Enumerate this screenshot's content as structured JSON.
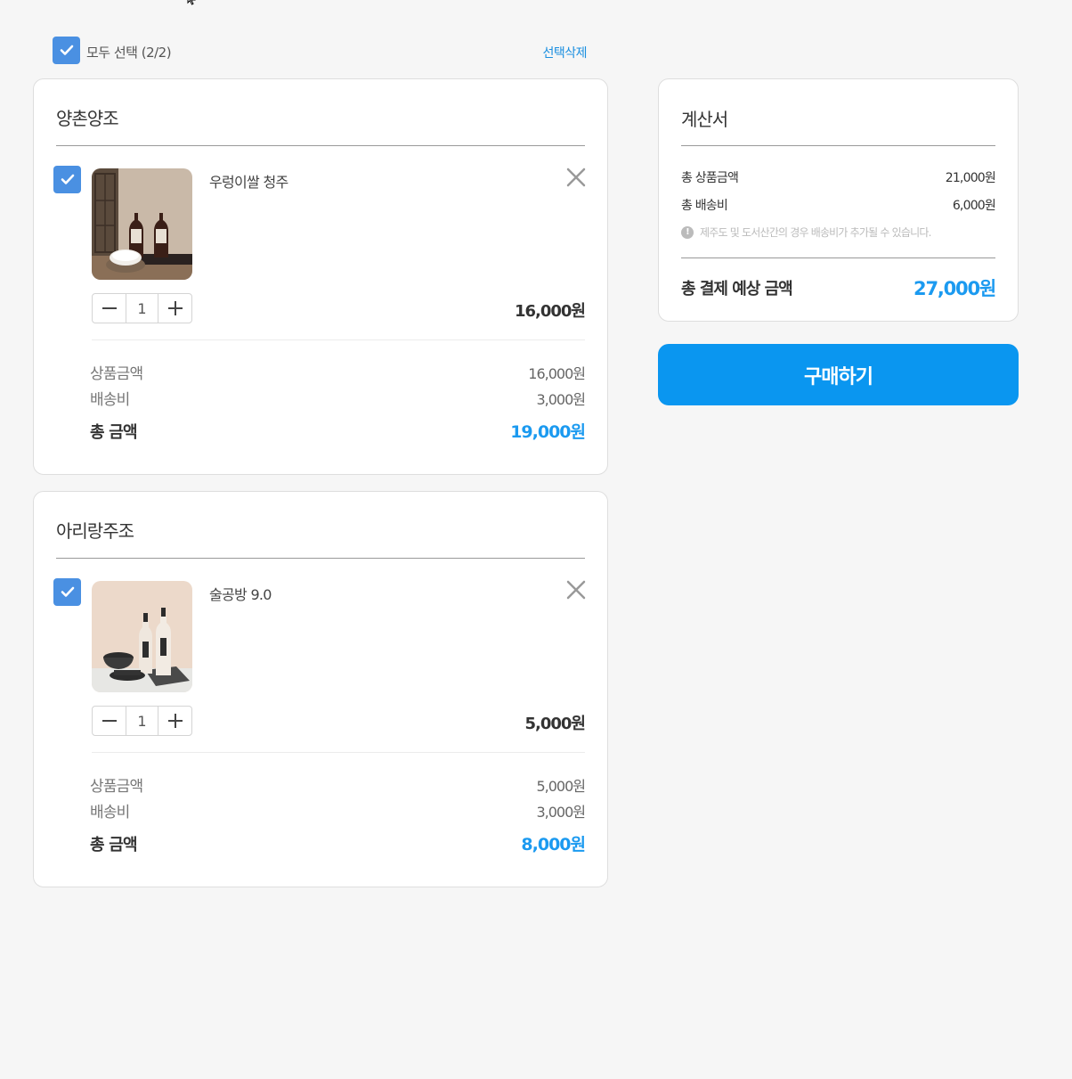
{
  "select_all": {
    "label": "모두 선택 (2/2)",
    "checked": true,
    "delete_label": "선택삭제"
  },
  "stores": [
    {
      "name": "양촌양조",
      "item": {
        "name": "우렁이쌀 청주",
        "checked": true,
        "quantity": "1",
        "price": "16,000원"
      },
      "summary": {
        "product_label": "상품금액",
        "product_value": "16,000원",
        "shipping_label": "배송비",
        "shipping_value": "3,000원",
        "total_label": "총 금액",
        "total_value": "19,000원"
      }
    },
    {
      "name": "아리랑주조",
      "item": {
        "name": "술공방 9.0",
        "checked": true,
        "quantity": "1",
        "price": "5,000원"
      },
      "summary": {
        "product_label": "상품금액",
        "product_value": "5,000원",
        "shipping_label": "배송비",
        "shipping_value": "3,000원",
        "total_label": "총 금액",
        "total_value": "8,000원"
      }
    }
  ],
  "invoice": {
    "title": "계산서",
    "total_product_label": "총 상품금액",
    "total_product_value": "21,000원",
    "total_shipping_label": "총 배송비",
    "total_shipping_value": "6,000원",
    "note": "제주도 및 도서산간의 경우 배송비가 추가될 수 있습니다.",
    "grand_total_label": "총 결제 예상 금액",
    "grand_total_value": "27,000원"
  },
  "buy_button_label": "구매하기",
  "colors": {
    "accent": "#0a96f0",
    "checkbox": "#4a90e2",
    "background": "#f6f6f6"
  }
}
